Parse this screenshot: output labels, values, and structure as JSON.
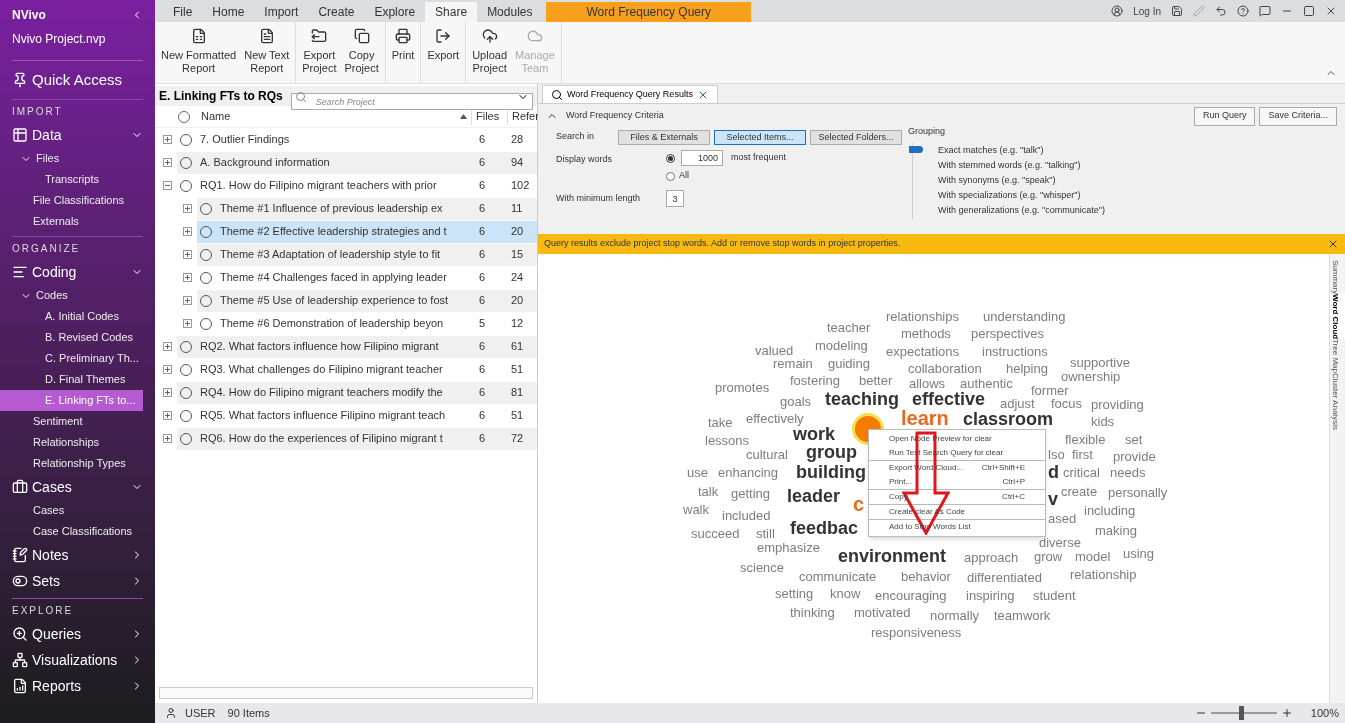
{
  "sidebar": {
    "app_name": "NVivo",
    "project": "Nvivo Project.nvp",
    "quick_access": "Quick Access",
    "sections": [
      {
        "heading": "IMPORT",
        "groups": [
          {
            "label": "Data",
            "expanded": true,
            "children": [
              {
                "label": "Files",
                "expanded": true,
                "selected": false,
                "children": [
                  {
                    "label": "Transcripts",
                    "selected": false
                  }
                ]
              },
              {
                "label": "File Classifications",
                "selected": false
              },
              {
                "label": "Externals",
                "selected": false
              }
            ]
          }
        ]
      },
      {
        "heading": "ORGANIZE",
        "groups": [
          {
            "label": "Coding",
            "expanded": true,
            "children": [
              {
                "label": "Codes",
                "expanded": true,
                "selected": false,
                "children": [
                  {
                    "label": "A. Initial Codes",
                    "selected": false
                  },
                  {
                    "label": "B. Revised Codes",
                    "selected": false
                  },
                  {
                    "label": "C. Preliminary Th...",
                    "selected": false
                  },
                  {
                    "label": "D. Final Themes",
                    "selected": false
                  },
                  {
                    "label": "E. Linking FTs to...",
                    "selected": true
                  }
                ]
              },
              {
                "label": "Sentiment",
                "selected": false
              },
              {
                "label": "Relationships",
                "selected": false
              },
              {
                "label": "Relationship Types",
                "selected": false
              }
            ]
          },
          {
            "label": "Cases",
            "expanded": true,
            "children": [
              {
                "label": "Cases",
                "selected": false
              },
              {
                "label": "Case Classifications",
                "selected": false
              }
            ]
          },
          {
            "label": "Notes",
            "expanded": false
          },
          {
            "label": "Sets",
            "expanded": false
          }
        ]
      },
      {
        "heading": "EXPLORE",
        "groups": [
          {
            "label": "Queries",
            "expanded": false
          },
          {
            "label": "Visualizations",
            "expanded": false
          },
          {
            "label": "Reports",
            "expanded": false
          }
        ]
      }
    ]
  },
  "ribbon": {
    "tabs": [
      {
        "label": "File",
        "selected": false,
        "kind": "plain"
      },
      {
        "label": "Home",
        "selected": false,
        "kind": "plain"
      },
      {
        "label": "Import",
        "selected": false,
        "kind": "plain"
      },
      {
        "label": "Create",
        "selected": false,
        "kind": "plain"
      },
      {
        "label": "Explore",
        "selected": false,
        "kind": "plain"
      },
      {
        "label": "Share",
        "selected": true,
        "kind": "plain"
      },
      {
        "label": "Modules",
        "selected": false,
        "kind": "plain"
      },
      {
        "label": "Word Frequency Query",
        "selected": false,
        "kind": "contextual"
      }
    ],
    "groups": [
      [
        {
          "label": "New Formatted\nReport",
          "disabled": false
        },
        {
          "label": "New Text\nReport",
          "disabled": false
        }
      ],
      [
        {
          "label": "Export\nProject",
          "disabled": false
        },
        {
          "label": "Copy\nProject",
          "disabled": false
        }
      ],
      [
        {
          "label": "Print",
          "disabled": false
        }
      ],
      [
        {
          "label": "Export",
          "disabled": false
        }
      ],
      [
        {
          "label": "Upload\nProject",
          "disabled": false
        },
        {
          "label": "Manage\nTeam",
          "disabled": true
        }
      ]
    ],
    "login": "Log In"
  },
  "tree": {
    "title": "E. Linking FTs to RQs",
    "search_placeholder": "Search Project",
    "columns": [
      "Name",
      "Files",
      "Refer"
    ],
    "rows": [
      {
        "name": "7. Outlier Findings",
        "files": "6",
        "refs": "28",
        "expanded": false,
        "selected": false
      },
      {
        "name": "A. Background information",
        "files": "6",
        "refs": "94",
        "expanded": false,
        "selected": false
      },
      {
        "name": "RQ1. How do Filipino migrant teachers with prior",
        "files": "6",
        "refs": "102",
        "expanded": true,
        "selected": false,
        "children": [
          {
            "name": "Theme #1 Influence of previous leadership ex",
            "files": "6",
            "refs": "11",
            "expanded": false,
            "selected": false
          },
          {
            "name": "Theme #2 Effective leadership strategies and t",
            "files": "6",
            "refs": "20",
            "expanded": false,
            "selected": true
          },
          {
            "name": "Theme #3 Adaptation of leadership style to fit",
            "files": "6",
            "refs": "15",
            "expanded": false,
            "selected": false
          },
          {
            "name": "Theme #4 Challenges faced in applying leader",
            "files": "6",
            "refs": "24",
            "expanded": false,
            "selected": false
          },
          {
            "name": "Theme #5 Use of leadership experience to fost",
            "files": "6",
            "refs": "20",
            "expanded": false,
            "selected": false
          },
          {
            "name": "Theme #6 Demonstration of leadership beyon",
            "files": "5",
            "refs": "12",
            "expanded": false,
            "selected": false
          }
        ]
      },
      {
        "name": "RQ2. What factors influence how Filipino migrant",
        "files": "6",
        "refs": "61",
        "expanded": false,
        "selected": false
      },
      {
        "name": "RQ3. What challenges do Filipino migrant teacher",
        "files": "6",
        "refs": "51",
        "expanded": false,
        "selected": false
      },
      {
        "name": "RQ4. How do Filipino migrant teachers modify the",
        "files": "6",
        "refs": "81",
        "expanded": false,
        "selected": false
      },
      {
        "name": "RQ5. What factors influence Filipino migrant teach",
        "files": "6",
        "refs": "51",
        "expanded": false,
        "selected": false
      },
      {
        "name": "RQ6. How do the experiences of Filipino migrant t",
        "files": "6",
        "refs": "72",
        "expanded": false,
        "selected": false
      }
    ]
  },
  "query": {
    "tab": "Word Frequency Query Results",
    "criteria_title": "Word Frequency Criteria",
    "criteria_expanded": true,
    "actions": [
      "Run Query",
      "Save Criteria..."
    ],
    "search_in_label": "Search in",
    "search_in": [
      {
        "label": "Files & Externals",
        "selected": false
      },
      {
        "label": "Selected Items...",
        "selected": true
      },
      {
        "label": "Selected Folders...",
        "selected": false
      }
    ],
    "display_label": "Display words",
    "display_options": [
      {
        "kind": "count",
        "value": "1000",
        "suffix": "most frequent",
        "selected": true
      },
      {
        "kind": "all",
        "label": "All",
        "selected": false
      }
    ],
    "min_length_label": "With minimum length",
    "min_length": "3",
    "grouping_label": "Grouping",
    "grouping": [
      {
        "label": "Exact matches (e.g. \"talk\")",
        "selected": true
      },
      {
        "label": "With stemmed words (e.g. \"talking\")",
        "selected": false
      },
      {
        "label": "With synonyms (e.g. \"speak\")",
        "selected": false
      },
      {
        "label": "With specializations (e.g. \"whisper\")",
        "selected": false
      },
      {
        "label": "With generalizations (e.g. \"communicate\")",
        "selected": false
      }
    ],
    "banner": "Query results exclude project stop words. Add or remove stop words in project properties.",
    "side_tabs": [
      {
        "label": "Summary",
        "selected": false
      },
      {
        "label": "Word Cloud",
        "selected": true
      },
      {
        "label": "Tree Map",
        "selected": false
      },
      {
        "label": "Cluster Analysis",
        "selected": false
      }
    ],
    "words": [
      {
        "text": "teacher",
        "kind": "minor"
      },
      {
        "text": "relationships",
        "kind": "minor"
      },
      {
        "text": "understanding",
        "kind": "minor"
      },
      {
        "text": "methods",
        "kind": "minor"
      },
      {
        "text": "perspectives",
        "kind": "minor"
      },
      {
        "text": "valued",
        "kind": "minor"
      },
      {
        "text": "modeling",
        "kind": "minor"
      },
      {
        "text": "expectations",
        "kind": "minor"
      },
      {
        "text": "instructions",
        "kind": "minor"
      },
      {
        "text": "remain",
        "kind": "minor"
      },
      {
        "text": "guiding",
        "kind": "minor"
      },
      {
        "text": "collaboration",
        "kind": "minor"
      },
      {
        "text": "helping",
        "kind": "minor"
      },
      {
        "text": "supportive",
        "kind": "minor"
      },
      {
        "text": "promotes",
        "kind": "minor"
      },
      {
        "text": "fostering",
        "kind": "minor"
      },
      {
        "text": "better",
        "kind": "minor"
      },
      {
        "text": "allows",
        "kind": "minor"
      },
      {
        "text": "authentic",
        "kind": "minor"
      },
      {
        "text": "ownership",
        "kind": "minor"
      },
      {
        "text": "former",
        "kind": "minor"
      },
      {
        "text": "goals",
        "kind": "minor"
      },
      {
        "text": "teaching",
        "kind": "major"
      },
      {
        "text": "effective",
        "kind": "major"
      },
      {
        "text": "adjust",
        "kind": "minor"
      },
      {
        "text": "focus",
        "kind": "minor"
      },
      {
        "text": "providing",
        "kind": "minor"
      },
      {
        "text": "take",
        "kind": "minor"
      },
      {
        "text": "effectively",
        "kind": "minor"
      },
      {
        "text": "learn",
        "kind": "accent"
      },
      {
        "text": "classroom",
        "kind": "major"
      },
      {
        "text": "kids",
        "kind": "minor"
      },
      {
        "text": "lessons",
        "kind": "minor"
      },
      {
        "text": "work",
        "kind": "major"
      },
      {
        "text": "flexible",
        "kind": "minor"
      },
      {
        "text": "set",
        "kind": "minor"
      },
      {
        "text": "cultural",
        "kind": "minor"
      },
      {
        "text": "group",
        "kind": "major"
      },
      {
        "text": "lso",
        "kind": "minor"
      },
      {
        "text": "first",
        "kind": "minor"
      },
      {
        "text": "provide",
        "kind": "minor"
      },
      {
        "text": "use",
        "kind": "minor"
      },
      {
        "text": "enhancing",
        "kind": "minor"
      },
      {
        "text": "building",
        "kind": "major"
      },
      {
        "text": "d",
        "kind": "major"
      },
      {
        "text": "critical",
        "kind": "minor"
      },
      {
        "text": "needs",
        "kind": "minor"
      },
      {
        "text": "talk",
        "kind": "minor"
      },
      {
        "text": "getting",
        "kind": "minor"
      },
      {
        "text": "leader",
        "kind": "major"
      },
      {
        "text": "c",
        "kind": "accent"
      },
      {
        "text": "v",
        "kind": "major"
      },
      {
        "text": "create",
        "kind": "minor"
      },
      {
        "text": "personally",
        "kind": "minor"
      },
      {
        "text": "walk",
        "kind": "minor"
      },
      {
        "text": "included",
        "kind": "minor"
      },
      {
        "text": "ased",
        "kind": "minor"
      },
      {
        "text": "including",
        "kind": "minor"
      },
      {
        "text": "succeed",
        "kind": "minor"
      },
      {
        "text": "still",
        "kind": "minor"
      },
      {
        "text": "feedbac",
        "kind": "major"
      },
      {
        "text": "making",
        "kind": "minor"
      },
      {
        "text": "emphasize",
        "kind": "minor"
      },
      {
        "text": "diverse",
        "kind": "minor"
      },
      {
        "text": "environment",
        "kind": "major"
      },
      {
        "text": "approach",
        "kind": "minor"
      },
      {
        "text": "grow",
        "kind": "minor"
      },
      {
        "text": "model",
        "kind": "minor"
      },
      {
        "text": "using",
        "kind": "minor"
      },
      {
        "text": "science",
        "kind": "minor"
      },
      {
        "text": "communicate",
        "kind": "minor"
      },
      {
        "text": "behavior",
        "kind": "minor"
      },
      {
        "text": "differentiated",
        "kind": "minor"
      },
      {
        "text": "relationship",
        "kind": "minor"
      },
      {
        "text": "setting",
        "kind": "minor"
      },
      {
        "text": "know",
        "kind": "minor"
      },
      {
        "text": "encouraging",
        "kind": "minor"
      },
      {
        "text": "inspiring",
        "kind": "minor"
      },
      {
        "text": "student",
        "kind": "minor"
      },
      {
        "text": "thinking",
        "kind": "minor"
      },
      {
        "text": "motivated",
        "kind": "minor"
      },
      {
        "text": "normally",
        "kind": "minor"
      },
      {
        "text": "teamwork",
        "kind": "minor"
      },
      {
        "text": "responsiveness",
        "kind": "minor"
      }
    ],
    "menu": [
      [
        {
          "label": "Open Node Preview for clear"
        },
        {
          "label": "Run Text Search Query for clear"
        }
      ],
      [
        {
          "label": "Export Word Cloud...",
          "shortcut": "Ctrl+Shift+E"
        },
        {
          "label": "Print...",
          "shortcut": "Ctrl+P"
        }
      ],
      [
        {
          "label": "Copy",
          "shortcut": "Ctrl+C"
        }
      ],
      [
        {
          "label": "Create clear As Code"
        }
      ],
      [
        {
          "label": "Add to Stop Words List"
        }
      ]
    ]
  },
  "status": {
    "user": "USER",
    "items": "90 Items",
    "zoom": {
      "level": 0.45
    },
    "zoom_label": "100%"
  }
}
